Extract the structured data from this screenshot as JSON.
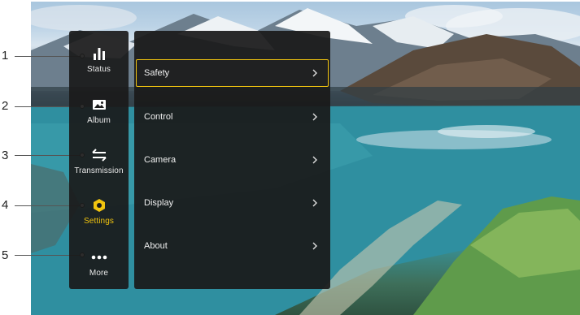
{
  "callouts": [
    "1",
    "2",
    "3",
    "4",
    "5"
  ],
  "nav": {
    "items": [
      {
        "label": "Status",
        "icon": "bar-chart-icon"
      },
      {
        "label": "Album",
        "icon": "image-icon"
      },
      {
        "label": "Transmission",
        "icon": "transfer-arrows-icon"
      },
      {
        "label": "Settings",
        "icon": "hexagon-settings-icon",
        "active": true
      },
      {
        "label": "More",
        "icon": "more-dots-icon"
      }
    ]
  },
  "settings_menu": {
    "items": [
      {
        "label": "Safety",
        "selected": true
      },
      {
        "label": "Control"
      },
      {
        "label": "Camera"
      },
      {
        "label": "Display"
      },
      {
        "label": "About"
      }
    ]
  },
  "colors": {
    "accent": "#f1c40f",
    "panel_bg": "#1a1a1a",
    "text": "#f0f0f0"
  }
}
